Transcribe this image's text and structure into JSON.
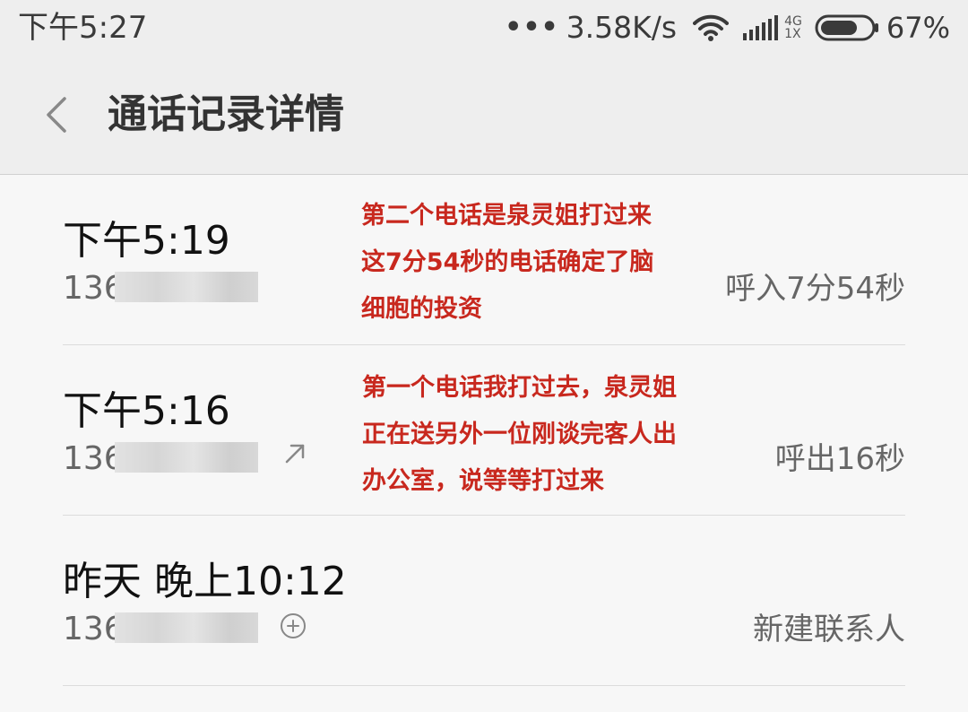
{
  "status_bar": {
    "time": "下午5:27",
    "dots": "•••",
    "net_speed": "3.58K/s",
    "net_type_top": "4G",
    "net_type_bottom": "1X",
    "battery": "67%",
    "icons": [
      "wifi-icon",
      "signal-icon",
      "battery-icon"
    ]
  },
  "header": {
    "title": "通话记录详情",
    "back_icon": "chevron-left-icon"
  },
  "calls": [
    {
      "time": "下午5:19",
      "number": "136",
      "action": "呼入7分54秒",
      "note": [
        "第二个电话是泉灵姐打过来",
        "这7分54秒的电话确定了脑",
        "细胞的投资"
      ]
    },
    {
      "time": "下午5:16",
      "number": "136",
      "action": "呼出16秒",
      "icon": "outgoing-arrow-icon",
      "note": [
        "第一个电话我打过去，泉灵姐",
        "正在送另外一位刚谈完客人出",
        "办公室，说等等打过来"
      ]
    },
    {
      "time": "昨天 晚上10:12",
      "number": "136",
      "action": "新建联系人",
      "icon": "add-circle-icon"
    }
  ],
  "colors": {
    "annotation": "#c8281e",
    "background": "#f7f7f7",
    "header": "#eeeeee"
  }
}
